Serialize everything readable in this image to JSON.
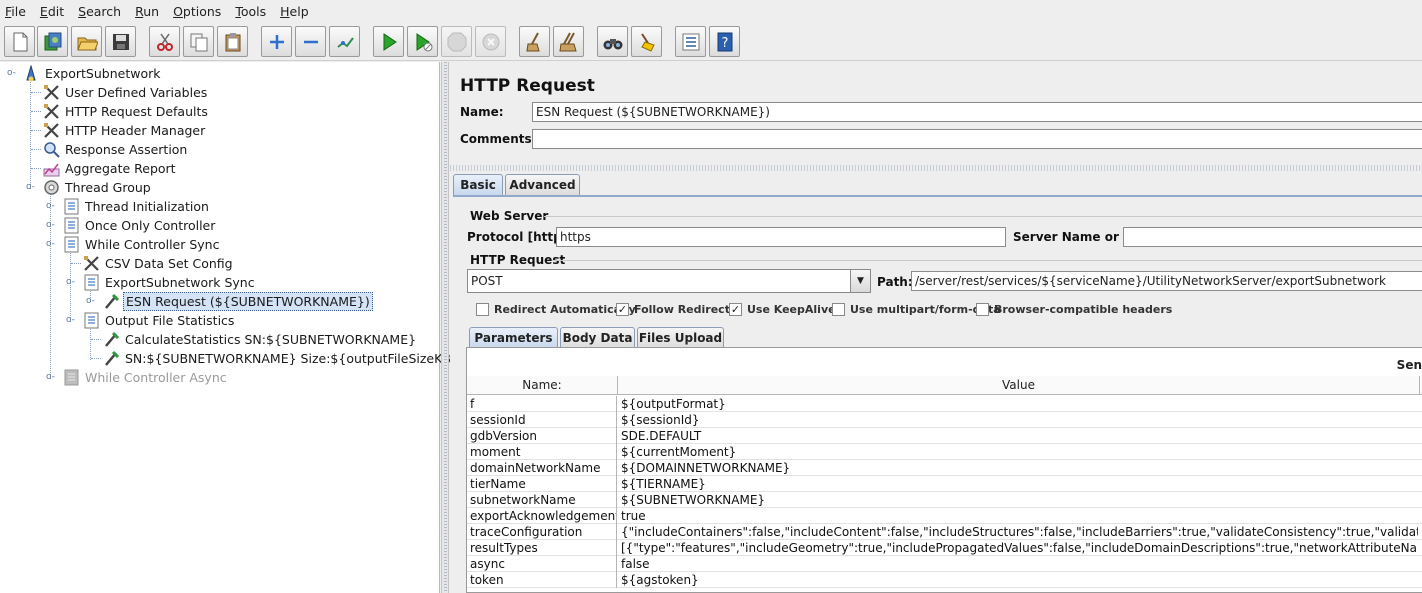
{
  "menu": [
    {
      "label": "File",
      "mnemonic": "F",
      "rest": "ile"
    },
    {
      "label": "Edit",
      "mnemonic": "E",
      "rest": "dit"
    },
    {
      "label": "Search",
      "mnemonic": "S",
      "rest": "earch"
    },
    {
      "label": "Run",
      "mnemonic": "R",
      "rest": "un"
    },
    {
      "label": "Options",
      "mnemonic": "O",
      "rest": "ptions"
    },
    {
      "label": "Tools",
      "mnemonic": "T",
      "rest": "ools"
    },
    {
      "label": "Help",
      "mnemonic": "H",
      "rest": "elp"
    }
  ],
  "toolbar": [
    {
      "icon": "new-icon"
    },
    {
      "icon": "templates-icon"
    },
    {
      "icon": "open-icon"
    },
    {
      "icon": "save-icon"
    },
    {
      "icon": "cut-icon"
    },
    {
      "icon": "copy-icon"
    },
    {
      "icon": "paste-icon"
    },
    {
      "icon": "expand-icon"
    },
    {
      "icon": "collapse-icon"
    },
    {
      "icon": "toggle-icon"
    },
    {
      "icon": "start-icon"
    },
    {
      "icon": "start-no-pauses-icon"
    },
    {
      "icon": "stop-icon"
    },
    {
      "icon": "shutdown-icon"
    },
    {
      "icon": "clear-icon"
    },
    {
      "icon": "clear-all-icon"
    },
    {
      "icon": "search-icon"
    },
    {
      "icon": "reset-search-icon"
    },
    {
      "icon": "function-helper-icon"
    },
    {
      "icon": "help-icon"
    }
  ],
  "tree": [
    {
      "label": "ExportSubnetwork",
      "icon": "test-plan-icon"
    },
    {
      "label": "User Defined Variables",
      "icon": "config-element-icon"
    },
    {
      "label": "HTTP Request Defaults",
      "icon": "config-element-icon"
    },
    {
      "label": "HTTP Header Manager",
      "icon": "config-element-icon"
    },
    {
      "label": "Response Assertion",
      "icon": "assertion-icon"
    },
    {
      "label": "Aggregate Report",
      "icon": "listener-icon"
    },
    {
      "label": "Thread Group",
      "icon": "thread-group-icon"
    },
    {
      "label": "Thread Initialization",
      "icon": "controller-icon"
    },
    {
      "label": "Once Only Controller",
      "icon": "controller-icon"
    },
    {
      "label": "While Controller Sync",
      "icon": "controller-icon"
    },
    {
      "label": "CSV Data Set Config",
      "icon": "config-element-icon"
    },
    {
      "label": "ExportSubnetwork Sync",
      "icon": "controller-icon"
    },
    {
      "label": "ESN Request (${SUBNETWORKNAME})",
      "icon": "sampler-icon"
    },
    {
      "label": "Output File Statistics",
      "icon": "controller-icon"
    },
    {
      "label": "CalculateStatistics SN:${SUBNETWORKNAME}",
      "icon": "sampler-icon"
    },
    {
      "label": "SN:${SUBNETWORKNAME} Size:${outputFileSizeKB}KB",
      "icon": "sampler-icon"
    },
    {
      "label": "While Controller Async",
      "icon": "controller-disabled-icon"
    }
  ],
  "panel": {
    "title": "HTTP Request",
    "name_label": "Name:",
    "name_value": "ESN Request (${SUBNETWORKNAME})",
    "comments_label": "Comments:",
    "comments_value": "",
    "tabs": [
      "Basic",
      "Advanced"
    ],
    "web_server_title": "Web Server",
    "protocol_label": "Protocol [http]:",
    "protocol_value": "https",
    "server_label": "Server Name or IP:",
    "server_value": "",
    "http_request_title": "HTTP Request",
    "method": "POST",
    "path_label": "Path:",
    "path_value": "/server/rest/services/${serviceName}/UtilityNetworkServer/exportSubnetwork",
    "checkboxes": [
      {
        "label": "Redirect Automatically",
        "checked": false
      },
      {
        "label": "Follow Redirects",
        "checked": true
      },
      {
        "label": "Use KeepAlive",
        "checked": true
      },
      {
        "label": "Use multipart/form-data",
        "checked": false
      },
      {
        "label": "Browser-compatible headers",
        "checked": false
      }
    ],
    "subtabs": [
      "Parameters",
      "Body Data",
      "Files Upload"
    ],
    "send_label": "Sen",
    "col_name": "Name:",
    "col_value": "Value",
    "params": [
      {
        "name": "f",
        "value": "${outputFormat}"
      },
      {
        "name": "sessionId",
        "value": "${sessionId}"
      },
      {
        "name": "gdbVersion",
        "value": "SDE.DEFAULT"
      },
      {
        "name": "moment",
        "value": "${currentMoment}"
      },
      {
        "name": "domainNetworkName",
        "value": "${DOMAINNETWORKNAME}"
      },
      {
        "name": "tierName",
        "value": "${TIERNAME}"
      },
      {
        "name": "subnetworkName",
        "value": "${SUBNETWORKNAME}"
      },
      {
        "name": "exportAcknowledgement",
        "value": "true"
      },
      {
        "name": "traceConfiguration",
        "value": "{\"includeContainers\":false,\"includeContent\":false,\"includeStructures\":false,\"includeBarriers\":true,\"validateConsistency\":true,\"validateLocatability\":f..."
      },
      {
        "name": "resultTypes",
        "value": "[{\"type\":\"features\",\"includeGeometry\":true,\"includePropagatedValues\":false,\"includeDomainDescriptions\":true,\"networkAttributeNames\":[\"Source I..."
      },
      {
        "name": "async",
        "value": "false"
      },
      {
        "name": "token",
        "value": "${agstoken}"
      }
    ]
  }
}
